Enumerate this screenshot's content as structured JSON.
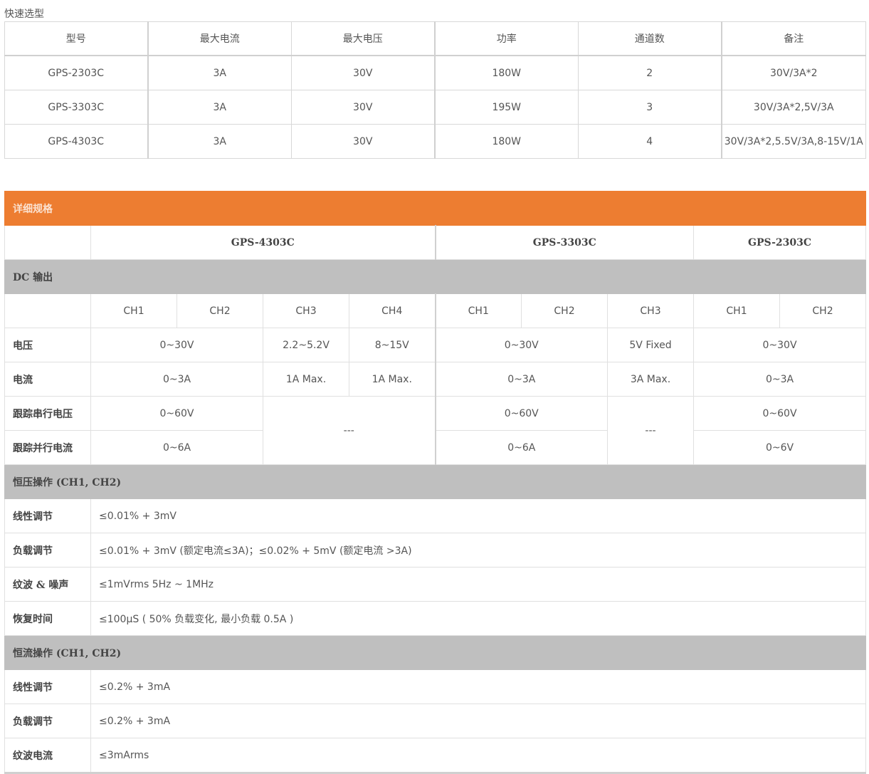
{
  "quick": {
    "title": "快速选型",
    "headers": [
      "型号",
      "最大电流",
      "最大电压",
      "功率",
      "通道数",
      "备注"
    ],
    "rows": [
      [
        "GPS-2303C",
        "3A",
        "30V",
        "180W",
        "2",
        "30V/3A*2"
      ],
      [
        "GPS-3303C",
        "3A",
        "30V",
        "195W",
        "3",
        "30V/3A*2,5V/3A"
      ],
      [
        "GPS-4303C",
        "3A",
        "30V",
        "180W",
        "4",
        "30V/3A*2,5.5V/3A,8-15V/1A"
      ]
    ]
  },
  "spec": {
    "title": "详细规格",
    "models": [
      "GPS-4303C",
      "GPS-3303C",
      "GPS-2303C"
    ],
    "dc_output": "DC 输出",
    "channels": [
      "CH1",
      "CH2",
      "CH3",
      "CH4",
      "CH1",
      "CH2",
      "CH3",
      "CH1",
      "CH2"
    ],
    "voltage": {
      "label": "电压",
      "v4303_ch12": "0~30V",
      "v4303_ch3": "2.2~5.2V",
      "v4303_ch4": "8~15V",
      "v3303_ch12": "0~30V",
      "v3303_ch3": "5V Fixed",
      "v2303": "0~30V"
    },
    "current": {
      "label": "电流",
      "c4303_ch12": "0~3A",
      "c4303_ch3": "1A Max.",
      "c4303_ch4": "1A Max.",
      "c3303_ch12": "0~3A",
      "c3303_ch3": "3A Max.",
      "c2303": "0~3A"
    },
    "series": {
      "label": "跟踪串行电压",
      "s4303": "0~60V",
      "s4303_na": "---",
      "s3303": "0~60V",
      "s3303_na": "---",
      "s2303": "0~60V"
    },
    "parallel": {
      "label": "跟踪并行电流",
      "p4303": "0~6A",
      "p3303": "0~6A",
      "p2303": "0~6V"
    },
    "cv": {
      "title": "恒压操作 (CH1, CH2)",
      "rows": [
        {
          "label": "线性调节",
          "value": "≤0.01% + 3mV"
        },
        {
          "label": "负载调节",
          "value": "≤0.01% + 3mV (额定电流≤3A)；≤0.02% + 5mV (额定电流 >3A)"
        },
        {
          "label": "纹波 & 噪声",
          "value": "≤1mVrms 5Hz ~ 1MHz"
        },
        {
          "label": "恢复时间",
          "value": "≤100μS ( 50% 负载变化, 最小负载 0.5A )"
        }
      ]
    },
    "cc": {
      "title": "恒流操作 (CH1, CH2)",
      "rows": [
        {
          "label": "线性调节",
          "value": "≤0.2% + 3mA"
        },
        {
          "label": "负载调节",
          "value": "≤0.2% + 3mA"
        },
        {
          "label": "纹波电流",
          "value": "≤3mArms"
        }
      ]
    }
  }
}
